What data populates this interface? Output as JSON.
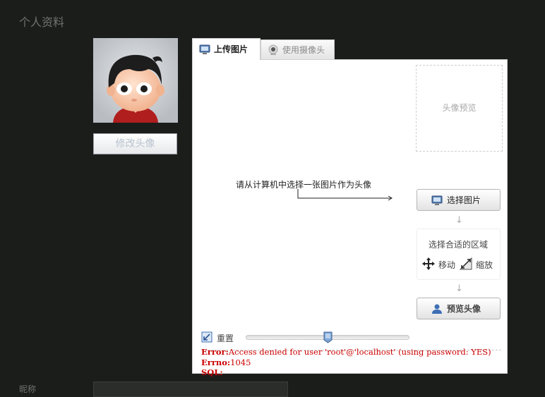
{
  "page": {
    "title": "个人资料"
  },
  "avatar": {
    "change_label": "修改头像"
  },
  "tabs": [
    {
      "label": "上传图片",
      "icon": "monitor-icon",
      "active": true
    },
    {
      "label": "使用摄像头",
      "icon": "webcam-icon",
      "active": false
    }
  ],
  "upload": {
    "preview_placeholder": "头像预览",
    "instruction": "请从计算机中选择一张图片作为头像",
    "select_button": "选择图片",
    "step_arrow": "↓",
    "region_title": "选择合适的区域",
    "move_label": "移动",
    "zoom_label": "缩放",
    "preview_button": "预览头像",
    "reset_label": "重置",
    "zoom_slider_value": 0.5
  },
  "error": {
    "error_label": "Error:",
    "error_text": "Access denied for user 'root'@'localhost' (using password: YES)",
    "errno_label": "Errno:",
    "errno_value": "1045",
    "sql_label": "SQL:"
  },
  "profile": {
    "nickname_label": "昵称",
    "nickname_value": ""
  },
  "colors": {
    "background": "#1b1d1b",
    "error": "#cc0000",
    "panel": "#ffffff"
  }
}
